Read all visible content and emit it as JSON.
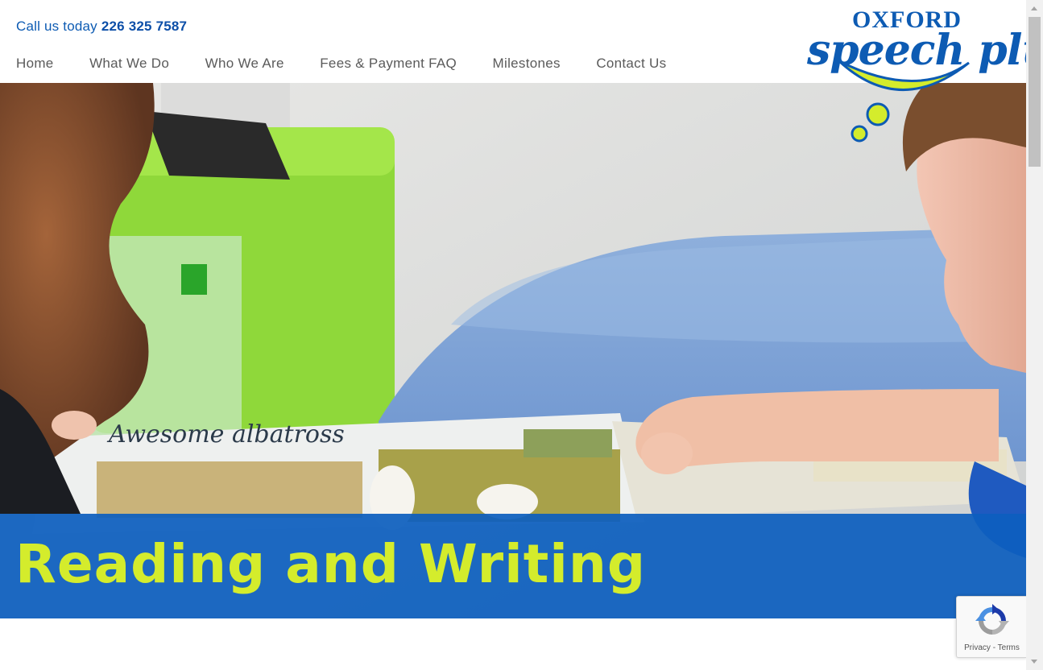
{
  "header": {
    "phone_prefix": "Call us today",
    "phone_number": "226 325 7587",
    "nav": [
      "Home",
      "What We Do",
      "Who We Are",
      "Fees & Payment FAQ",
      "Milestones",
      "Contact Us"
    ]
  },
  "logo": {
    "line1": "OXFORD",
    "line2": "speech plus"
  },
  "hero": {
    "photo_text": "Awesome albatross",
    "heading": "Reading and Writing"
  },
  "recaptcha": {
    "privacy": "Privacy",
    "separator": " - ",
    "terms": "Terms"
  },
  "colors": {
    "brand_blue": "#0d5bb3",
    "brand_lime": "#d4ec2c",
    "nav_text": "#5a5a5a"
  },
  "icons": [
    "recaptcha-icon",
    "scroll-up-arrow-icon",
    "scroll-down-arrow-icon"
  ]
}
